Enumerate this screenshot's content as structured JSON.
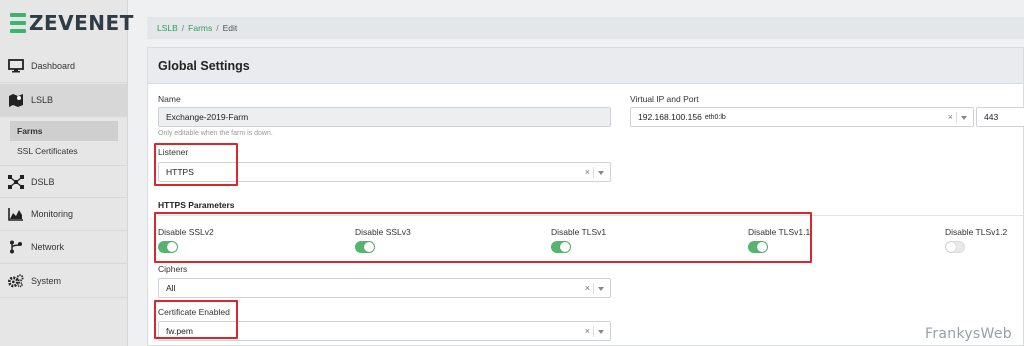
{
  "app": {
    "brand": "ZEVENET"
  },
  "sidebar": {
    "items": [
      {
        "label": "Dashboard",
        "icon": "monitor-icon"
      },
      {
        "label": "LSLB",
        "icon": "map-icon"
      },
      {
        "label": "DSLB",
        "icon": "network-nodes-icon"
      },
      {
        "label": "Monitoring",
        "icon": "chart-icon"
      },
      {
        "label": "Network",
        "icon": "branch-icon"
      },
      {
        "label": "System",
        "icon": "gears-icon"
      }
    ],
    "sub_items": [
      {
        "label": "Farms"
      },
      {
        "label": "SSL Certificates"
      }
    ]
  },
  "breadcrumb": {
    "items": [
      "LSLB",
      "Farms",
      "Edit"
    ],
    "sep": "/"
  },
  "card": {
    "title": "Global Settings",
    "name": {
      "label": "Name",
      "value": "Exchange-2019-Farm",
      "help": "Only editable when the farm is down."
    },
    "vip": {
      "label": "Virtual IP and Port",
      "ip": "192.168.100.156",
      "iface": "eth0:lb",
      "port": "443"
    },
    "listener": {
      "label": "Listener",
      "value": "HTTPS"
    },
    "https_params": {
      "title": "HTTPS Parameters",
      "toggles": [
        {
          "label": "Disable SSLv2",
          "on": true
        },
        {
          "label": "Disable SSLv3",
          "on": true
        },
        {
          "label": "Disable TLSv1",
          "on": true
        },
        {
          "label": "Disable TLSv1.1",
          "on": true
        },
        {
          "label": "Disable TLSv1.2",
          "on": false
        }
      ]
    },
    "ciphers": {
      "label": "Ciphers",
      "value": "All"
    },
    "certificate": {
      "label": "Certificate Enabled",
      "value": "fw.pem"
    }
  },
  "colors": {
    "accent": "#2e9e5b",
    "toggle_on": "#55b56f",
    "highlight": "#d9272e"
  },
  "watermark": "FrankysWeb"
}
